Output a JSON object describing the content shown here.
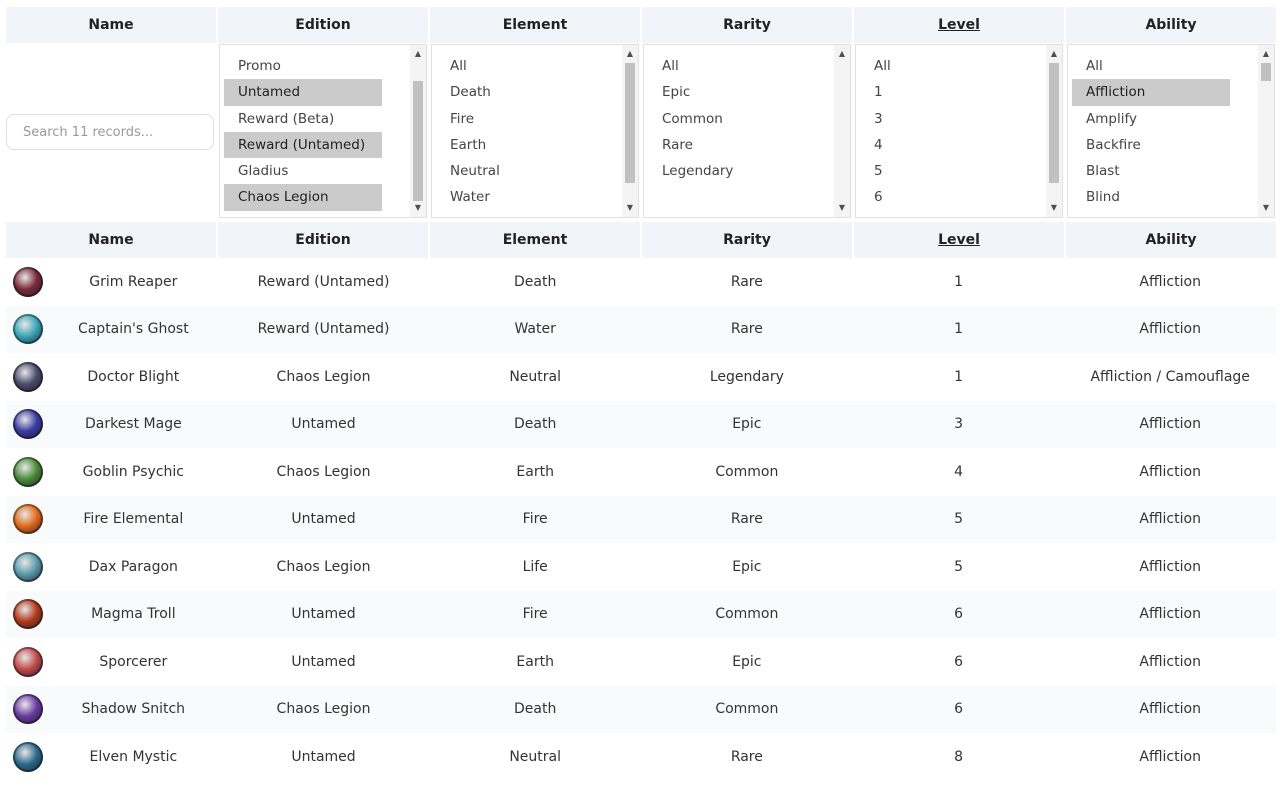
{
  "columns": [
    "Name",
    "Edition",
    "Element",
    "Rarity",
    "Level",
    "Ability"
  ],
  "sorted_column": "Level",
  "search": {
    "placeholder": "Search 11 records..."
  },
  "filters": {
    "edition": {
      "options": [
        "Promo",
        "Untamed",
        "Reward (Beta)",
        "Reward (Untamed)",
        "Gladius",
        "Chaos Legion"
      ],
      "selected": [
        "Untamed",
        "Reward (Untamed)",
        "Chaos Legion"
      ]
    },
    "element": {
      "options": [
        "All",
        "Death",
        "Fire",
        "Earth",
        "Neutral",
        "Water"
      ],
      "selected": []
    },
    "rarity": {
      "options": [
        "All",
        "Epic",
        "Common",
        "Rare",
        "Legendary"
      ],
      "selected": []
    },
    "level": {
      "options": [
        "All",
        "1",
        "3",
        "4",
        "5",
        "6"
      ],
      "selected": []
    },
    "ability": {
      "options": [
        "All",
        "Affliction",
        "Amplify",
        "Backfire",
        "Blast",
        "Blind"
      ],
      "selected": [
        "Affliction"
      ]
    }
  },
  "rows": [
    {
      "name": "Grim Reaper",
      "edition": "Reward (Untamed)",
      "element": "Death",
      "rarity": "Rare",
      "level": "1",
      "ability": "Affliction",
      "avatar_color": "#7a2a3a"
    },
    {
      "name": "Captain's Ghost",
      "edition": "Reward (Untamed)",
      "element": "Water",
      "rarity": "Rare",
      "level": "1",
      "ability": "Affliction",
      "avatar_color": "#3aa6b5"
    },
    {
      "name": "Doctor Blight",
      "edition": "Chaos Legion",
      "element": "Neutral",
      "rarity": "Legendary",
      "level": "1",
      "ability": "Affliction / Camouflage",
      "avatar_color": "#4a4a6a"
    },
    {
      "name": "Darkest Mage",
      "edition": "Untamed",
      "element": "Death",
      "rarity": "Epic",
      "level": "3",
      "ability": "Affliction",
      "avatar_color": "#3a3aa0"
    },
    {
      "name": "Goblin Psychic",
      "edition": "Chaos Legion",
      "element": "Earth",
      "rarity": "Common",
      "level": "4",
      "ability": "Affliction",
      "avatar_color": "#4a8a3a"
    },
    {
      "name": "Fire Elemental",
      "edition": "Untamed",
      "element": "Fire",
      "rarity": "Rare",
      "level": "5",
      "ability": "Affliction",
      "avatar_color": "#e06a1a"
    },
    {
      "name": "Dax Paragon",
      "edition": "Chaos Legion",
      "element": "Life",
      "rarity": "Epic",
      "level": "5",
      "ability": "Affliction",
      "avatar_color": "#5a9aaa"
    },
    {
      "name": "Magma Troll",
      "edition": "Untamed",
      "element": "Fire",
      "rarity": "Common",
      "level": "6",
      "ability": "Affliction",
      "avatar_color": "#b03a1a"
    },
    {
      "name": "Sporcerer",
      "edition": "Untamed",
      "element": "Earth",
      "rarity": "Epic",
      "level": "6",
      "ability": "Affliction",
      "avatar_color": "#c04a4a"
    },
    {
      "name": "Shadow Snitch",
      "edition": "Chaos Legion",
      "element": "Death",
      "rarity": "Common",
      "level": "6",
      "ability": "Affliction",
      "avatar_color": "#6a3aa0"
    },
    {
      "name": "Elven Mystic",
      "edition": "Untamed",
      "element": "Neutral",
      "rarity": "Rare",
      "level": "8",
      "ability": "Affliction",
      "avatar_color": "#2a6a8a"
    }
  ]
}
